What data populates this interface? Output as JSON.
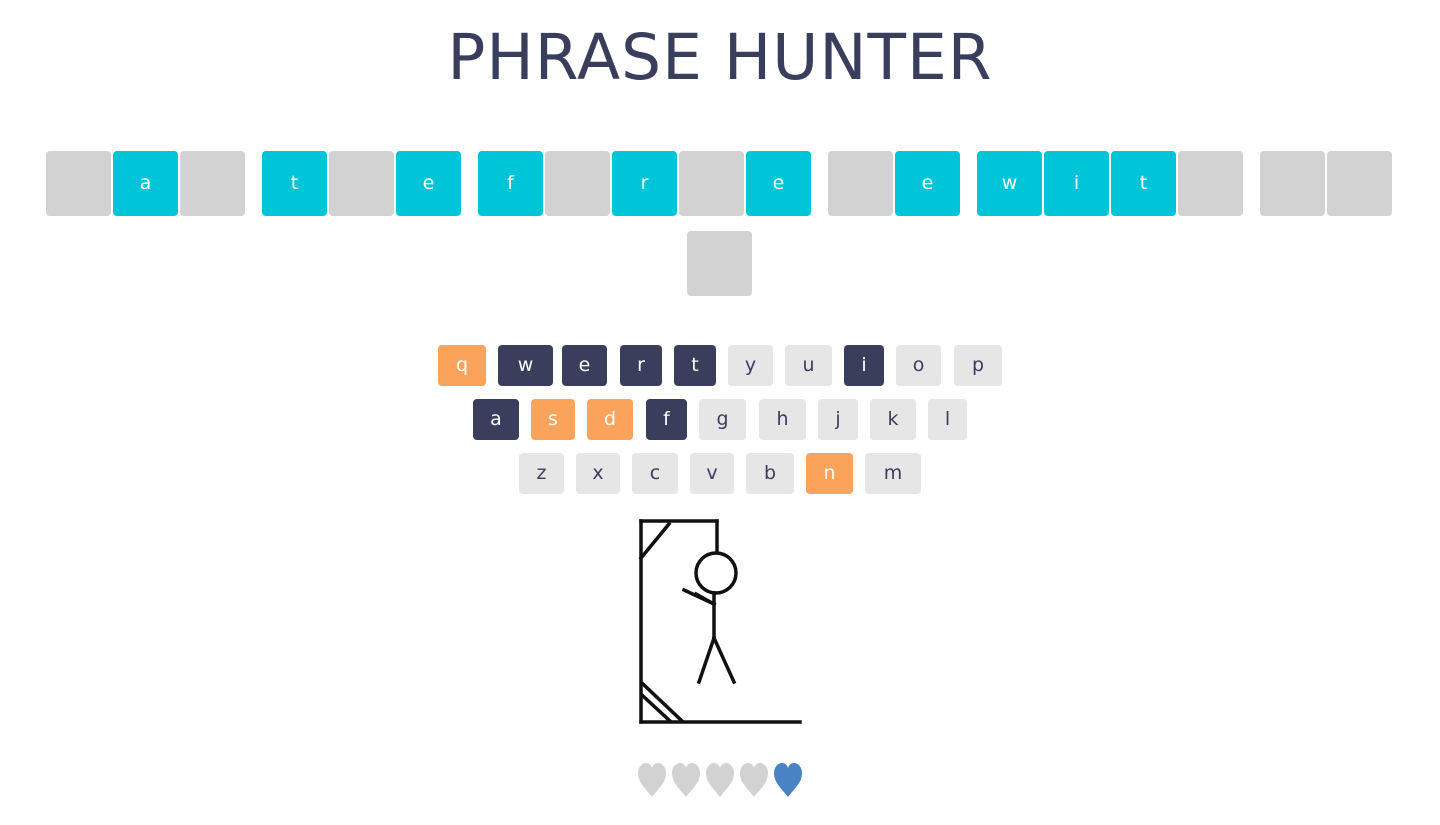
{
  "header": {
    "title": "PHRASE HUNTER"
  },
  "phrase": {
    "tiles": [
      {
        "letter": "",
        "revealed": false
      },
      {
        "letter": "a",
        "revealed": true
      },
      {
        "letter": "",
        "revealed": false
      },
      {
        "letter": "t",
        "revealed": true
      },
      {
        "letter": "",
        "revealed": false
      },
      {
        "letter": "e",
        "revealed": true
      },
      {
        "letter": "f",
        "revealed": true
      },
      {
        "letter": "",
        "revealed": false
      },
      {
        "letter": "r",
        "revealed": true
      },
      {
        "letter": "",
        "revealed": false
      },
      {
        "letter": "e",
        "revealed": true
      },
      {
        "letter": "",
        "revealed": false
      },
      {
        "letter": "e",
        "revealed": true
      },
      {
        "letter": "w",
        "revealed": true
      },
      {
        "letter": "i",
        "revealed": true
      },
      {
        "letter": "t",
        "revealed": true
      },
      {
        "letter": "",
        "revealed": false
      },
      {
        "letter": "",
        "revealed": false
      },
      {
        "letter": "",
        "revealed": false
      },
      {
        "letter": "",
        "revealed": false
      }
    ]
  },
  "keyboard": {
    "rows": [
      [
        {
          "label": "q",
          "state": "wrong"
        },
        {
          "label": "w",
          "state": "chosen"
        },
        {
          "label": "e",
          "state": "chosen"
        },
        {
          "label": "r",
          "state": "chosen"
        },
        {
          "label": "t",
          "state": "chosen"
        },
        {
          "label": "y",
          "state": "unused"
        },
        {
          "label": "u",
          "state": "unused"
        },
        {
          "label": "i",
          "state": "chosen"
        },
        {
          "label": "o",
          "state": "unused"
        },
        {
          "label": "p",
          "state": "unused"
        }
      ],
      [
        {
          "label": "a",
          "state": "chosen"
        },
        {
          "label": "s",
          "state": "wrong"
        },
        {
          "label": "d",
          "state": "wrong"
        },
        {
          "label": "f",
          "state": "chosen"
        },
        {
          "label": "g",
          "state": "unused"
        },
        {
          "label": "h",
          "state": "unused"
        },
        {
          "label": "j",
          "state": "unused"
        },
        {
          "label": "k",
          "state": "unused"
        },
        {
          "label": "l",
          "state": "unused"
        }
      ],
      [
        {
          "label": "z",
          "state": "unused"
        },
        {
          "label": "x",
          "state": "unused"
        },
        {
          "label": "c",
          "state": "unused"
        },
        {
          "label": "v",
          "state": "unused"
        },
        {
          "label": "b",
          "state": "unused"
        },
        {
          "label": "n",
          "state": "wrong"
        },
        {
          "label": "m",
          "state": "unused"
        }
      ]
    ]
  },
  "lives": {
    "total": 5,
    "remaining": 1,
    "lost_color": "#d2d2d2",
    "live_color": "#4a83c4"
  },
  "colors": {
    "title": "#3a3e5c",
    "tile_hidden": "#d2d2d2",
    "tile_revealed": "#00c5d8",
    "key_unused": "#e6e6e6",
    "key_chosen": "#3a3e5c",
    "key_wrong": "#f9a45a"
  },
  "icons": {
    "hangman": "hangman-figure-icon",
    "heart": "heart-icon"
  }
}
